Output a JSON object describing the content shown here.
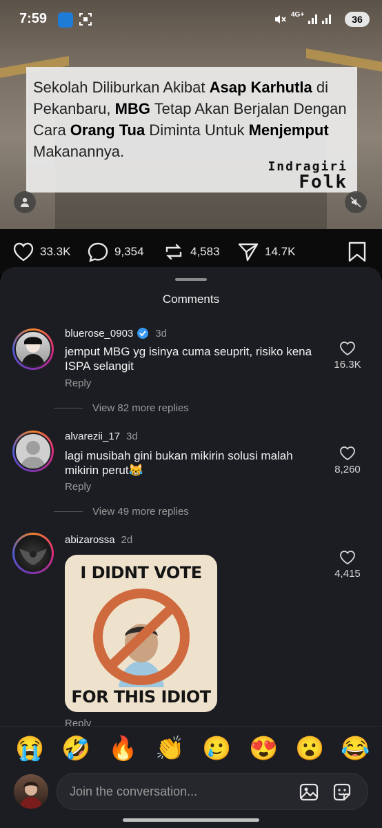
{
  "status": {
    "time": "7:59",
    "app_badge": "PLN mobile",
    "network": "4G+",
    "battery": "36"
  },
  "video": {
    "caption_parts": [
      {
        "t": "Sekolah Diliburkan Akibat ",
        "b": false
      },
      {
        "t": "Asap Karhutla",
        "b": true
      },
      {
        "t": " di Pekanbaru, ",
        "b": false
      },
      {
        "t": "MBG",
        "b": true
      },
      {
        "t": " Tetap Akan Berjalan Dengan Cara ",
        "b": false
      },
      {
        "t": "Orang Tua",
        "b": true
      },
      {
        "t": " Diminta Untuk ",
        "b": false
      },
      {
        "t": "Menjemput",
        "b": true
      },
      {
        "t": " Makanannya.",
        "b": false
      }
    ],
    "logo_line1": "Indragiri",
    "logo_line2": "Folk"
  },
  "actions": {
    "likes": "33.3K",
    "comments": "9,354",
    "reposts": "4,583",
    "shares": "14.7K"
  },
  "sheet": {
    "title": "Comments"
  },
  "comments": [
    {
      "user": "bluerose_0903",
      "verified": true,
      "when": "3d",
      "text": "jemput MBG yg isinya cuma seuprit, risiko kena ISPA selangit",
      "likes": "16.3K",
      "reply": "Reply",
      "more_replies": "View 82 more replies"
    },
    {
      "user": "alvarezii_17",
      "verified": false,
      "when": "3d",
      "text": "lagi musibah gini bukan mikirin solusi malah mikirin perut😹",
      "likes": "8,260",
      "reply": "Reply",
      "more_replies": "View 49 more replies"
    },
    {
      "user": "abizarossa",
      "verified": false,
      "when": "2d",
      "meme_top": "I DIDNT VOTE",
      "meme_bottom": "FOR THIS IDIOT",
      "likes": "4,415",
      "reply": "Reply"
    }
  ],
  "emojis": [
    "😭",
    "🤣",
    "🔥",
    "👏",
    "🥲",
    "😍",
    "😮",
    "😂"
  ],
  "composer": {
    "placeholder": "Join the conversation..."
  }
}
